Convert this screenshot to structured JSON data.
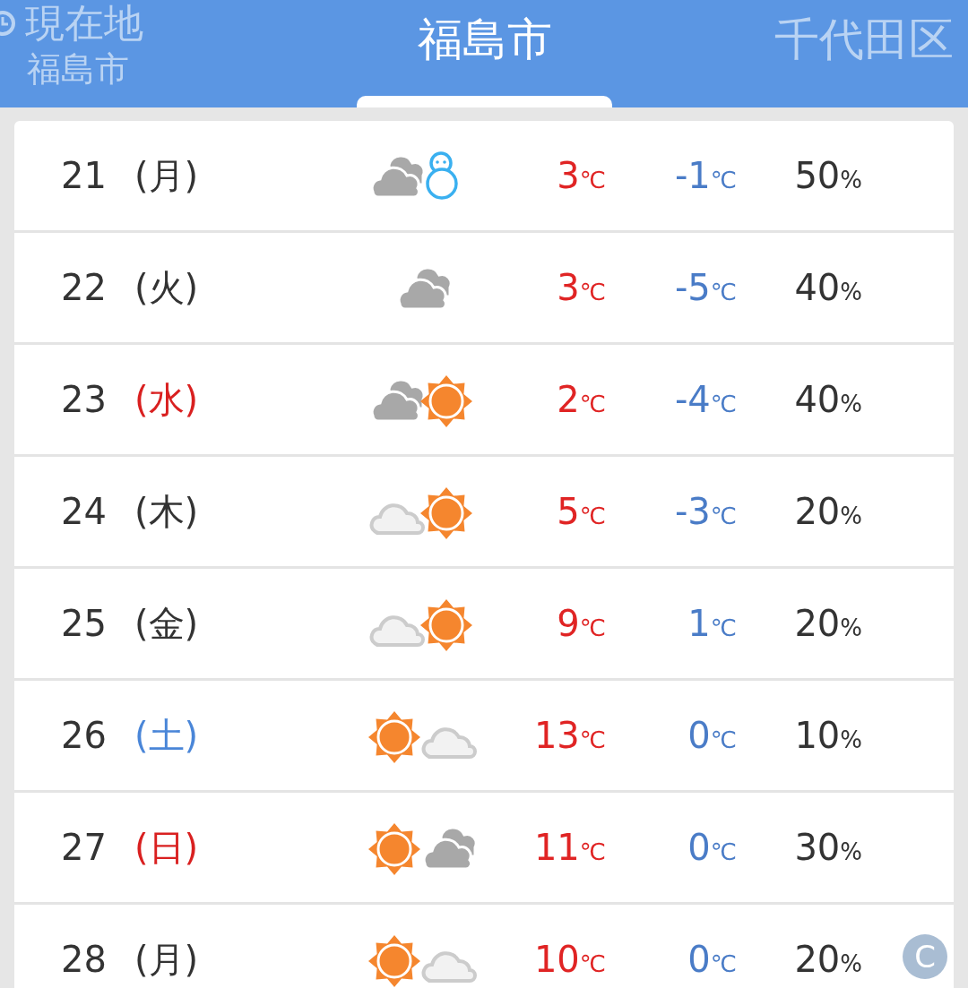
{
  "tabs": [
    {
      "label": "現在地",
      "sublabel": "福島市",
      "selected": false
    },
    {
      "label": "福島市",
      "selected": true
    },
    {
      "label": "千代田区",
      "selected": false
    }
  ],
  "days": [
    {
      "date": "21",
      "weekday": "(月)",
      "color": "#333333",
      "weather": [
        {
          "kind": "cloudy"
        },
        {
          "kind": "snowman"
        }
      ],
      "high": "3℃",
      "low": "-1℃",
      "precip": "50%"
    },
    {
      "date": "22",
      "weekday": "(火)",
      "color": "#333333",
      "weather": [
        {
          "kind": "cloudy"
        }
      ],
      "high": "3℃",
      "low": "-5℃",
      "precip": "40%"
    },
    {
      "date": "23",
      "weekday": "(水)",
      "color": "#d92020",
      "weather": [
        {
          "kind": "cloudy"
        },
        {
          "kind": "sun"
        }
      ],
      "high": "2℃",
      "low": "-4℃",
      "precip": "40%"
    },
    {
      "date": "24",
      "weekday": "(木)",
      "color": "#333333",
      "weather": [
        {
          "kind": "light_cloud"
        },
        {
          "kind": "sun"
        }
      ],
      "high": "5℃",
      "low": "-3℃",
      "precip": "20%"
    },
    {
      "date": "25",
      "weekday": "(金)",
      "color": "#333333",
      "weather": [
        {
          "kind": "light_cloud"
        },
        {
          "kind": "sun"
        }
      ],
      "high": "9℃",
      "low": "1℃",
      "precip": "20%"
    },
    {
      "date": "26",
      "weekday": "(土)",
      "color": "#4a86d8",
      "weather": [
        {
          "kind": "sun"
        },
        {
          "kind": "light_cloud"
        }
      ],
      "high": "13℃",
      "low": "0℃",
      "precip": "10%"
    },
    {
      "date": "27",
      "weekday": "(日)",
      "color": "#d92020",
      "weather": [
        {
          "kind": "sun"
        },
        {
          "kind": "cloudy"
        }
      ],
      "high": "11℃",
      "low": "0℃",
      "precip": "30%"
    },
    {
      "date": "28",
      "weekday": "(月)",
      "color": "#333333",
      "weather": [
        {
          "kind": "sun"
        },
        {
          "kind": "light_cloud"
        }
      ],
      "high": "10℃",
      "low": "0℃",
      "precip": "20%"
    }
  ],
  "badge": "C"
}
